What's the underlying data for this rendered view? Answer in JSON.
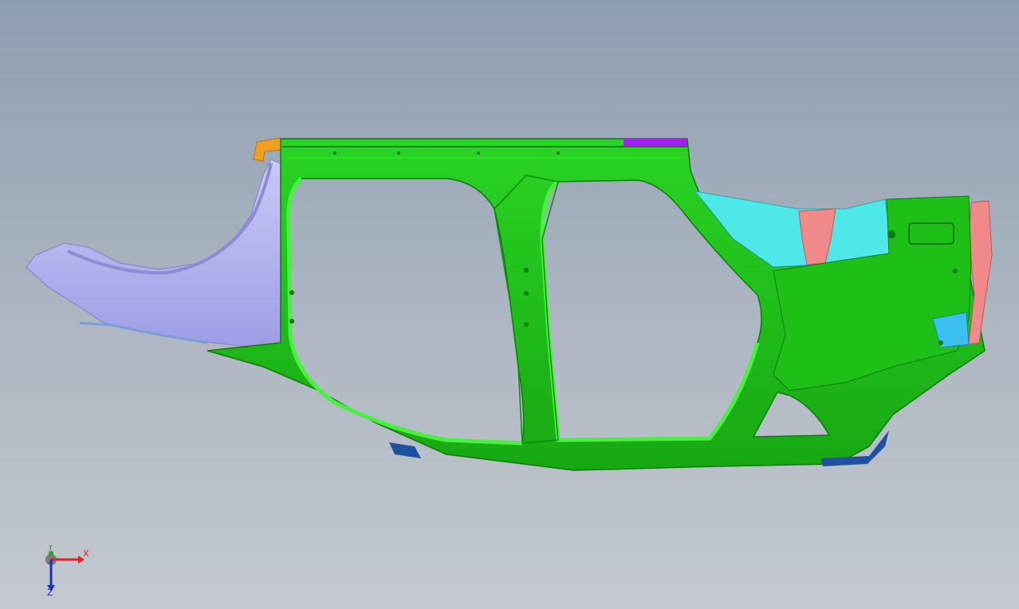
{
  "viewer": {
    "background_top": "#8d9db0",
    "background_bottom": "#c4c9cf"
  },
  "model": {
    "name_icon": "car-body-side-frame",
    "colors": {
      "side_frame": "#1fc41a",
      "side_frame_shadow": "#158a12",
      "front_fender": "#b9b9f0",
      "rear_inner": "#4fe8e8",
      "rear_bracket": "#f08a8a",
      "accent_purple": "#a020f0",
      "accent_orange": "#f0a020",
      "sill_blue": "#2050a0"
    }
  },
  "axis_triad": {
    "x_label": "X",
    "y_label": "Y",
    "z_label": "Z"
  }
}
